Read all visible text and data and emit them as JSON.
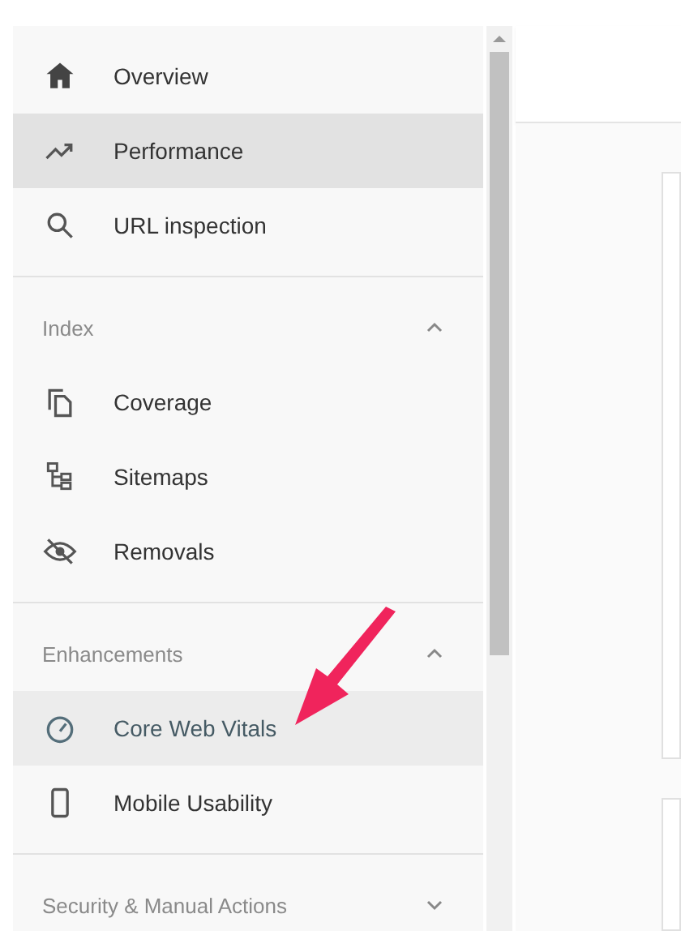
{
  "sidebar": {
    "sections": [
      {
        "items": [
          {
            "label": "Overview",
            "selected": false,
            "hovered": false
          },
          {
            "label": "Performance",
            "selected": true,
            "hovered": false
          },
          {
            "label": "URL inspection",
            "selected": false,
            "hovered": false
          }
        ]
      },
      {
        "title": "Index",
        "expanded": true,
        "items": [
          {
            "label": "Coverage",
            "selected": false,
            "hovered": false
          },
          {
            "label": "Sitemaps",
            "selected": false,
            "hovered": false
          },
          {
            "label": "Removals",
            "selected": false,
            "hovered": false
          }
        ]
      },
      {
        "title": "Enhancements",
        "expanded": true,
        "items": [
          {
            "label": "Core Web Vitals",
            "selected": false,
            "hovered": true
          },
          {
            "label": "Mobile Usability",
            "selected": false,
            "hovered": false
          }
        ]
      },
      {
        "title": "Security & Manual Actions",
        "expanded": false
      }
    ]
  }
}
